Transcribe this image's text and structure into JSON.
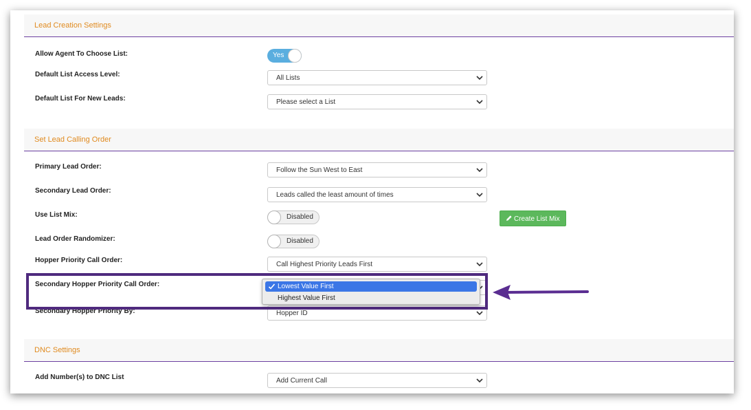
{
  "sections": {
    "lead_creation": {
      "title": "Lead Creation Settings",
      "allow_agent_label": "Allow Agent To Choose List:",
      "allow_agent_toggle": "Yes",
      "default_access_label": "Default List Access Level:",
      "default_access_value": "All Lists",
      "default_list_label": "Default List For New Leads:",
      "default_list_value": "Please select a List"
    },
    "calling_order": {
      "title": "Set Lead Calling Order",
      "primary_label": "Primary Lead Order:",
      "primary_value": "Follow the Sun West to East",
      "secondary_label": "Secondary Lead Order:",
      "secondary_value": "Leads called the least amount of times",
      "list_mix_label": "Use List Mix:",
      "list_mix_toggle": "Disabled",
      "create_list_mix_button": "Create List Mix",
      "randomizer_label": "Lead Order Randomizer:",
      "randomizer_toggle": "Disabled",
      "hopper_priority_label": "Hopper Priority Call Order:",
      "hopper_priority_value": "Call Highest Priority Leads First",
      "secondary_hopper_label": "Secondary Hopper Priority Call Order:",
      "secondary_hopper_options": [
        "Lowest Value First",
        "Highest Value First"
      ],
      "hopper_by_label": "Secondary Hopper Priority By:",
      "hopper_by_value": "Hopper ID"
    },
    "dnc": {
      "title": "DNC Settings",
      "add_numbers_label": "Add Number(s) to DNC List",
      "add_numbers_value": "Add Current Call"
    }
  },
  "colors": {
    "section_title": "#e08a1e",
    "section_rule": "#6b3fa0",
    "toggle_on": "#5aaedf",
    "button_green": "#5cb85c",
    "highlight": "#4f2a7e",
    "dropdown_selected": "#3b76e6"
  },
  "icons": [
    "chevron-down-icon",
    "pencil-icon",
    "checkmark-icon",
    "arrow-left-icon"
  ]
}
